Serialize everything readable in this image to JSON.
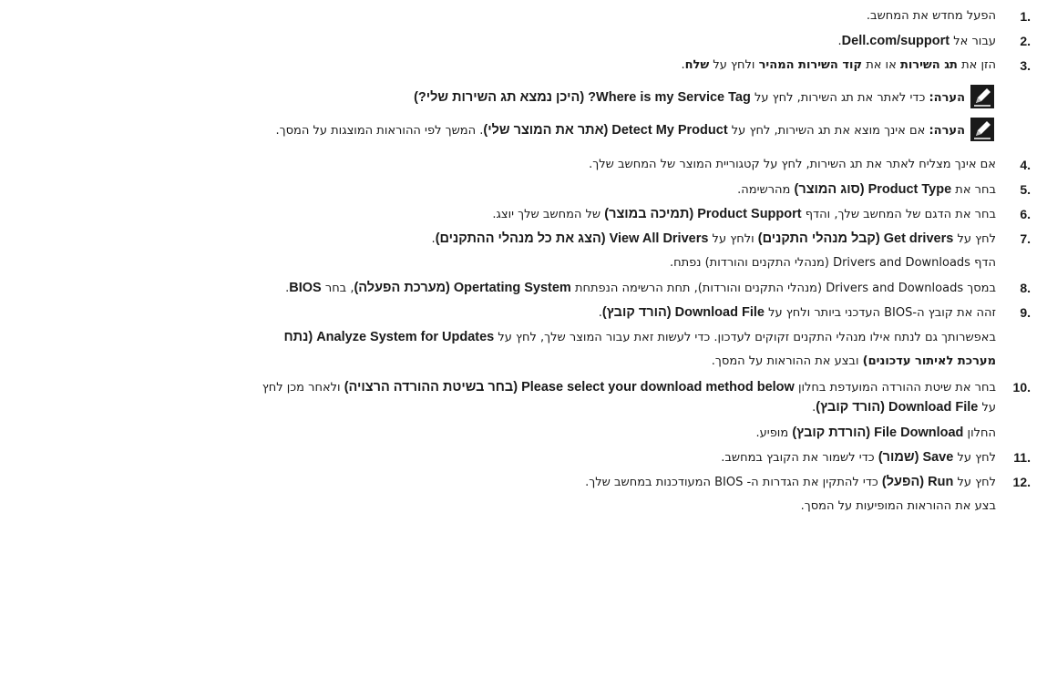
{
  "steps": [
    {
      "n": "1.",
      "text": "הפעל מחדש את המחשב."
    },
    {
      "n": "2.",
      "a": "עבור אל ",
      "b": "Dell.com/support",
      "c": "."
    },
    {
      "n": "3.",
      "a": "הזן את ",
      "b": "תג השירות",
      "c": " או את ",
      "d": "קוד השירות המהיר",
      "e": " ולחץ על ",
      "f": "שלח",
      "g": "."
    },
    {
      "n": "4.",
      "text": "אם אינך מצליח לאתר את תג השירות, לחץ על קטגוריית המוצר של המחשב שלך."
    },
    {
      "n": "5.",
      "a": "בחר את ",
      "b": "Product Type (סוג המוצר)",
      "c": " מהרשימה."
    },
    {
      "n": "6.",
      "a": "בחר את הדגם של המחשב שלך, והדף ",
      "b": "Product Support (תמיכה במוצר)",
      "c": " של המחשב שלך יוצג."
    },
    {
      "n": "7.",
      "a": "לחץ על ",
      "b": "Get drivers (קבל מנהלי התקנים)",
      "c": " ולחץ על ",
      "d": "View All Drivers (הצג את כל מנהלי ההתקנים)",
      "e": "."
    },
    {
      "n": "8.",
      "a": "במסך Drivers and Downloads (מנהלי התקנים והורדות), תחת הרשימה הנפתחת ",
      "b": "Opertating System (מערכת הפעלה)",
      "c": ", בחר ",
      "d": "BIOS",
      "e": "."
    },
    {
      "n": "9.",
      "a": "זהה את קובץ ה-BIOS העדכני ביותר ולחץ על ",
      "b": "Download File (הורד קובץ)",
      "c": "."
    },
    {
      "n": "10.",
      "a": "בחר את שיטת ההורדה המועדפת בחלון ",
      "b": "Please select your download method below (בחר בשיטת ההורדה הרצויה)",
      "c": " ולאחר מכן לחץ",
      "line2a": "על ",
      "line2b": "Download File (הורד קובץ)",
      "line2c": "."
    },
    {
      "n": "11.",
      "a": "לחץ על ",
      "b": "Save (שמור)",
      "c": " כדי לשמור את הקובץ במחשב."
    },
    {
      "n": "12.",
      "a": "לחץ על ",
      "b": "Run (הפעל)",
      "c": " כדי להתקין את הגדרות ה- BIOS המעודכנות במחשב שלך."
    }
  ],
  "notes": [
    {
      "label": "הערה:",
      "a": " כדי לאתר את תג השירות, לחץ על ",
      "b": "Where is my Service Tag? (היכן נמצא תג השירות שלי?)"
    },
    {
      "label": "הערה:",
      "a": " אם אינך מוצא את תג השירות, לחץ על ",
      "b": "Detect My Product (אתר את המוצר שלי)",
      "c": ". המשך לפי ההוראות המוצגות על המסך."
    }
  ],
  "continuations": {
    "after7": "הדף Drivers and Downloads (מנהלי התקנים והורדות) נפתח.",
    "after9_a": "באפשרותך גם לנתח אילו מנהלי התקנים זקוקים לעדכון. כדי לעשות זאת עבור המוצר שלך, לחץ על ",
    "after9_b": "Analyze System for Updates (נתח",
    "after9_line2_b": "מערכת לאיתור עדכונים)",
    "after9_line2_c": " ובצע את ההוראות על המסך.",
    "after10_a": "החלון ",
    "after10_b": "File Download (הורדת קובץ)",
    "after10_c": " מופיע.",
    "after12": "בצע את ההוראות המופיעות על המסך."
  },
  "icons": {
    "note": "pencil-note-icon"
  }
}
